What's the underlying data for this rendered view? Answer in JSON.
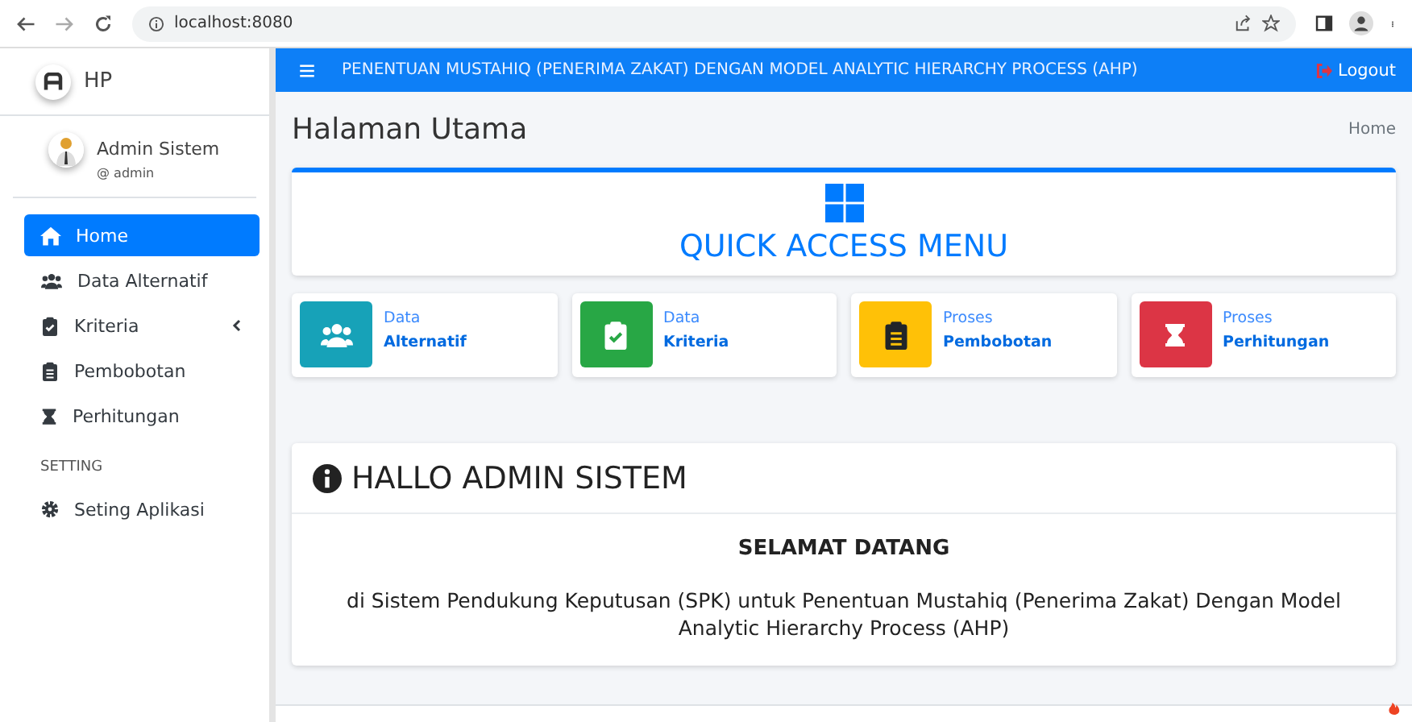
{
  "browser": {
    "url": "localhost:8080"
  },
  "brand": {
    "name": "HP"
  },
  "user": {
    "name": "Admin Sistem",
    "handle": "@ admin"
  },
  "sidebar": {
    "items": [
      {
        "label": "Home",
        "selected": true
      },
      {
        "label": "Data Alternatif",
        "selected": false
      },
      {
        "label": "Kriteria",
        "selected": false,
        "expanded": false
      },
      {
        "label": "Pembobotan",
        "selected": false
      },
      {
        "label": "Perhitungan",
        "selected": false
      }
    ],
    "section": "SETTING",
    "settings_items": [
      {
        "label": "Seting Aplikasi",
        "selected": false
      }
    ]
  },
  "topbar": {
    "title": "PENENTUAN MUSTAHIQ (PENERIMA ZAKAT) DENGAN MODEL ANALYTIC HIERARCHY PROCESS (AHP)",
    "logout": "Logout"
  },
  "page": {
    "title": "Halaman Utama",
    "breadcrumb": "Home"
  },
  "quick_access": {
    "title": "QUICK ACCESS MENU"
  },
  "quick_cards": [
    {
      "line1": "Data",
      "line2": "Alternatif",
      "color": "#17a2b8"
    },
    {
      "line1": "Data",
      "line2": "Kriteria",
      "color": "#28a745"
    },
    {
      "line1": "Proses",
      "line2": "Pembobotan",
      "color": "#ffc107"
    },
    {
      "line1": "Proses",
      "line2": "Perhitungan",
      "color": "#dc3545"
    }
  ],
  "welcome": {
    "title": "HALLO ADMIN SISTEM",
    "heading": "SELAMAT DATANG",
    "text": "di Sistem Pendukung Keputusan (SPK) untuk Penentuan Mustahiq (Penerima Zakat) Dengan Model Analytic Hierarchy Process (AHP)"
  }
}
